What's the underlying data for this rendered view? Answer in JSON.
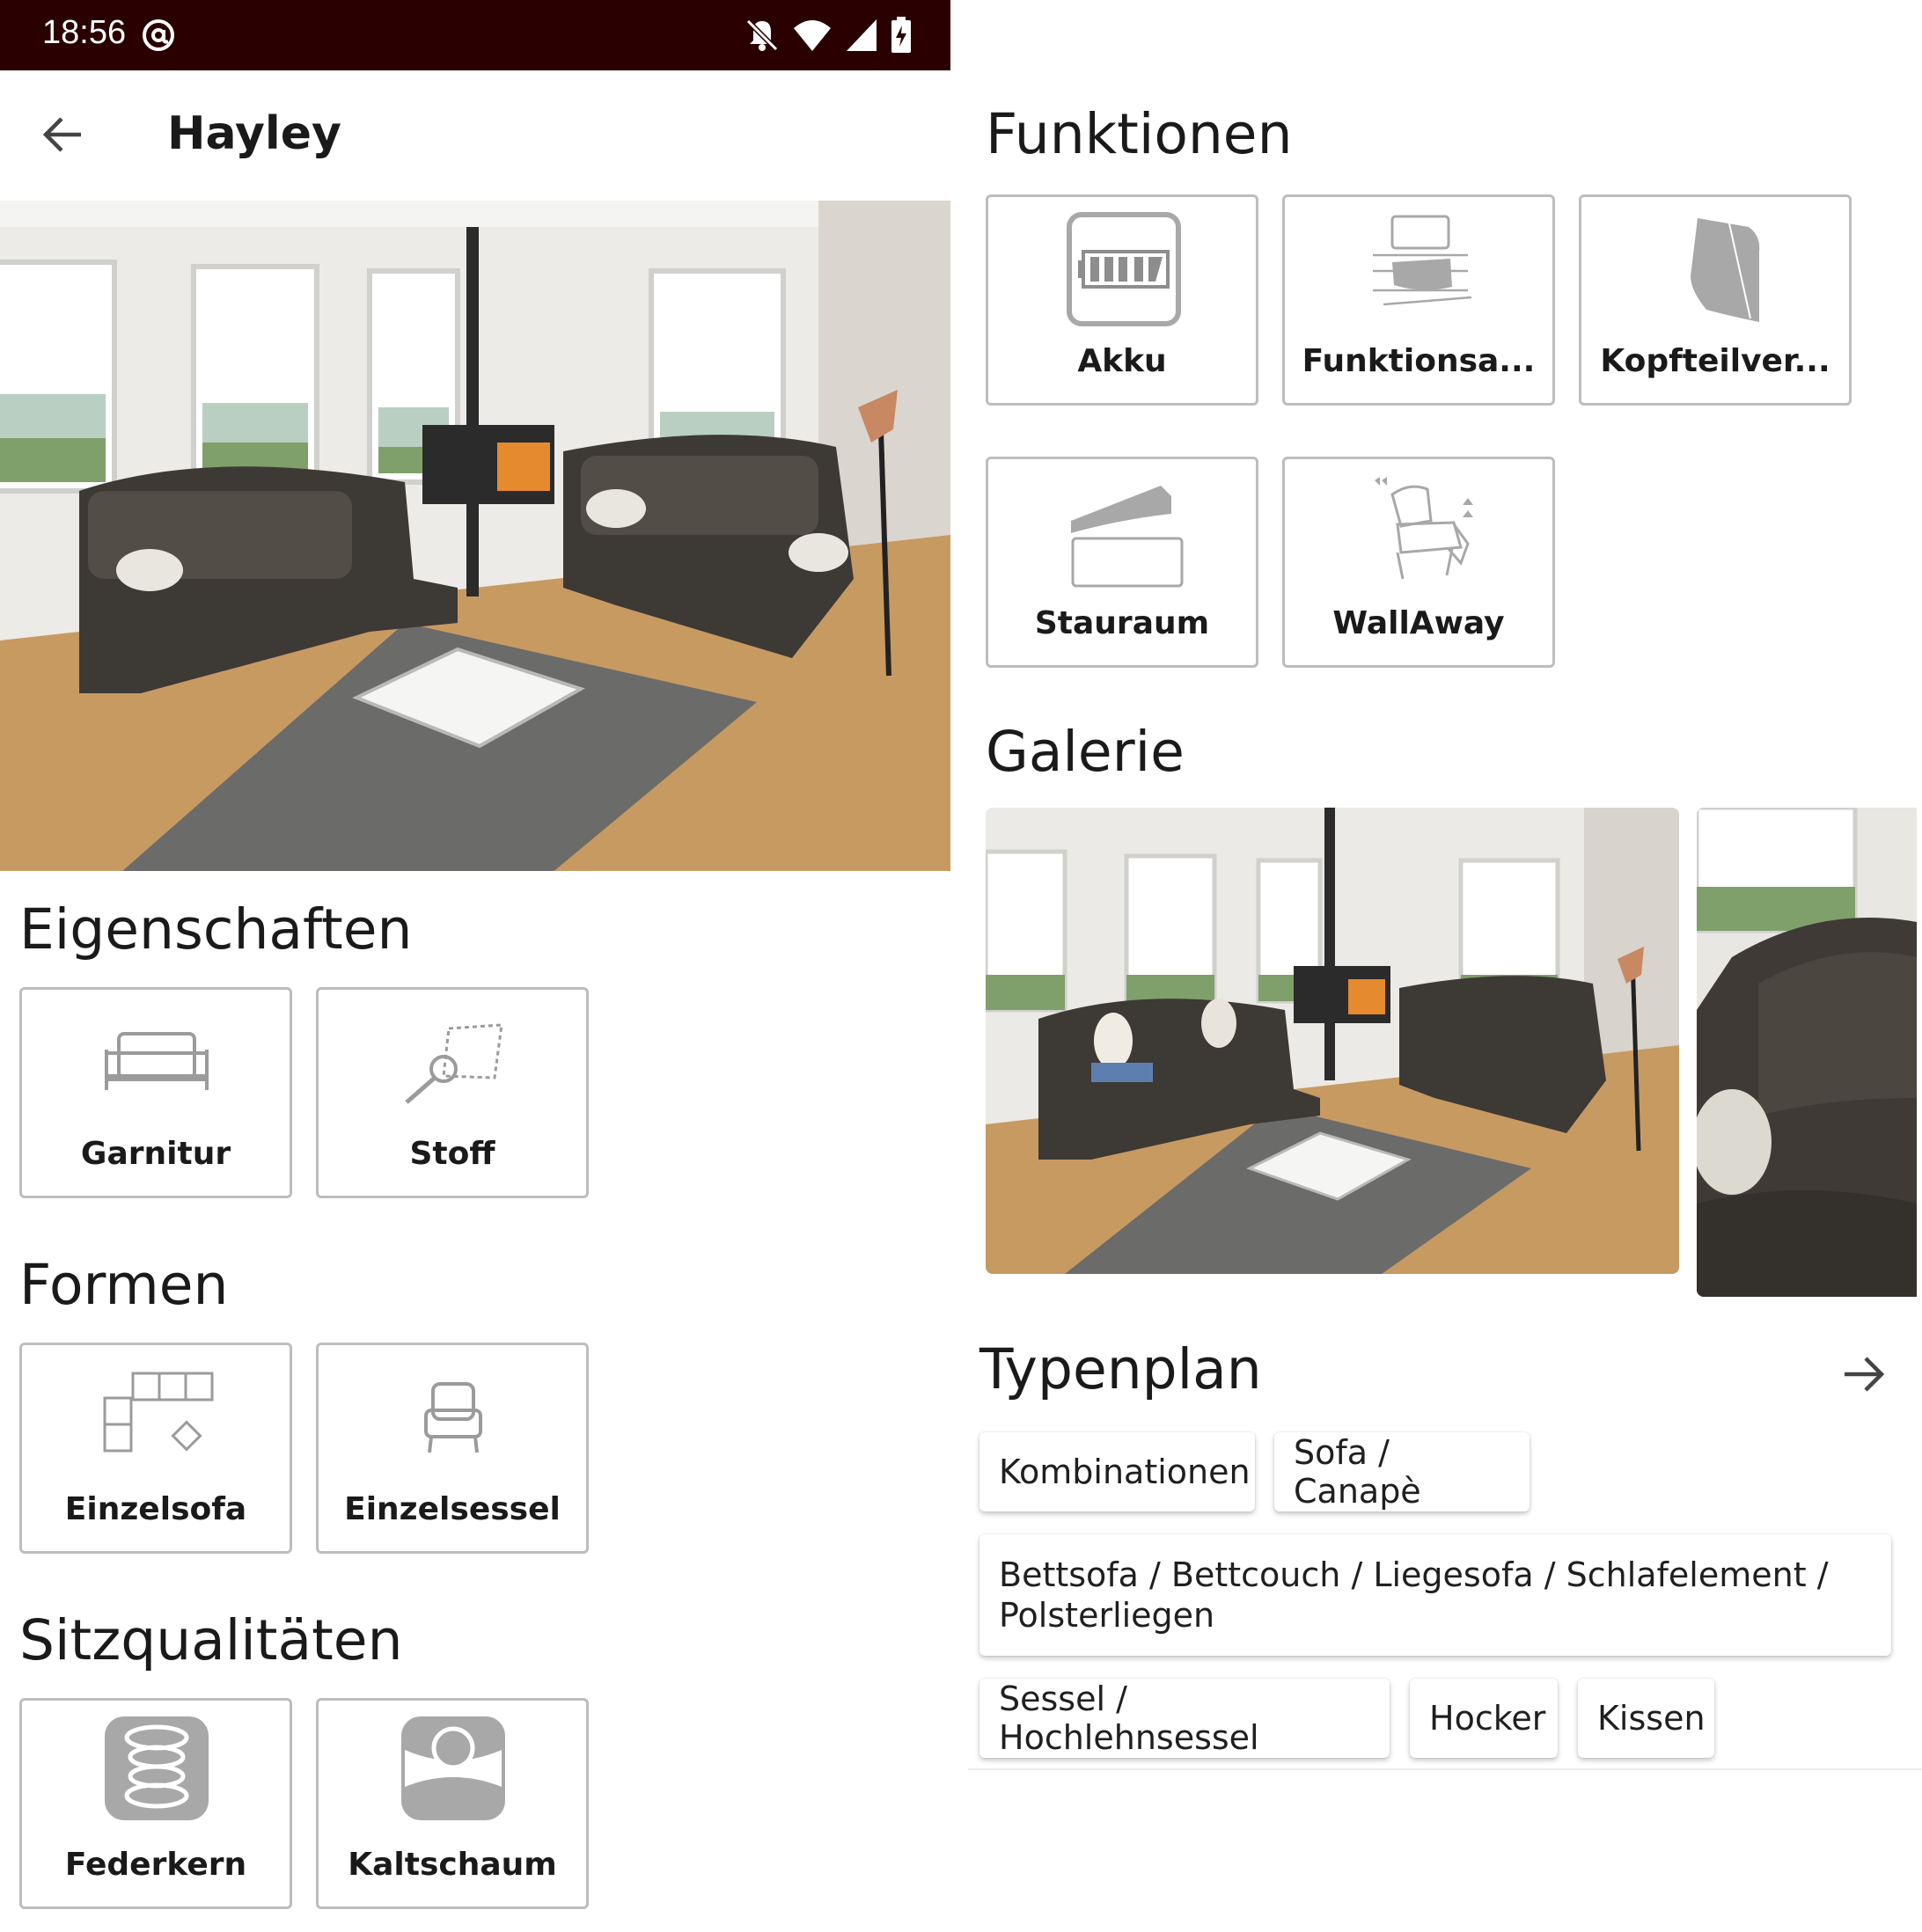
{
  "status_bar": {
    "time": "18:56"
  },
  "header": {
    "title": "Hayley"
  },
  "sections": {
    "eigenschaften": {
      "title": "Eigenschaften",
      "items": [
        {
          "label": "Garnitur",
          "icon": "sofa-icon"
        },
        {
          "label": "Stoff",
          "icon": "fabric-sample-icon"
        }
      ]
    },
    "formen": {
      "title": "Formen",
      "items": [
        {
          "label": "Einzelsofa",
          "icon": "sofa-layout-icon"
        },
        {
          "label": "Einzelsessel",
          "icon": "armchair-icon"
        }
      ]
    },
    "sitzqualitaeten": {
      "title": "Sitzqualitäten",
      "items": [
        {
          "label": "Federkern",
          "icon": "spring-core-icon"
        },
        {
          "label": "Kaltschaum",
          "icon": "cold-foam-icon"
        }
      ]
    },
    "funktionen": {
      "title": "Funktionen",
      "items": [
        {
          "label": "Akku",
          "icon": "battery-icon"
        },
        {
          "label": "Funktionsa...",
          "icon": "function-seat-icon"
        },
        {
          "label": "Kopfteilver...",
          "icon": "headrest-icon"
        },
        {
          "label": "Stauraum",
          "icon": "storage-icon"
        },
        {
          "label": "WallAway",
          "icon": "wallaway-recliner-icon"
        }
      ]
    },
    "galerie": {
      "title": "Galerie"
    },
    "typenplan": {
      "title": "Typenplan",
      "chips": [
        "Kombinationen",
        "Sofa / Canapè",
        "Bettsofa / Bettcouch / Liegesofa / Schlafelement / Polsterliegen",
        "Sessel / Hochlehnsessel",
        "Hocker",
        "Kissen"
      ]
    }
  },
  "colors": {
    "status_bar": "#2a0000",
    "card_border": "#bdbdbd",
    "icon_gray": "#a8a8a8"
  }
}
